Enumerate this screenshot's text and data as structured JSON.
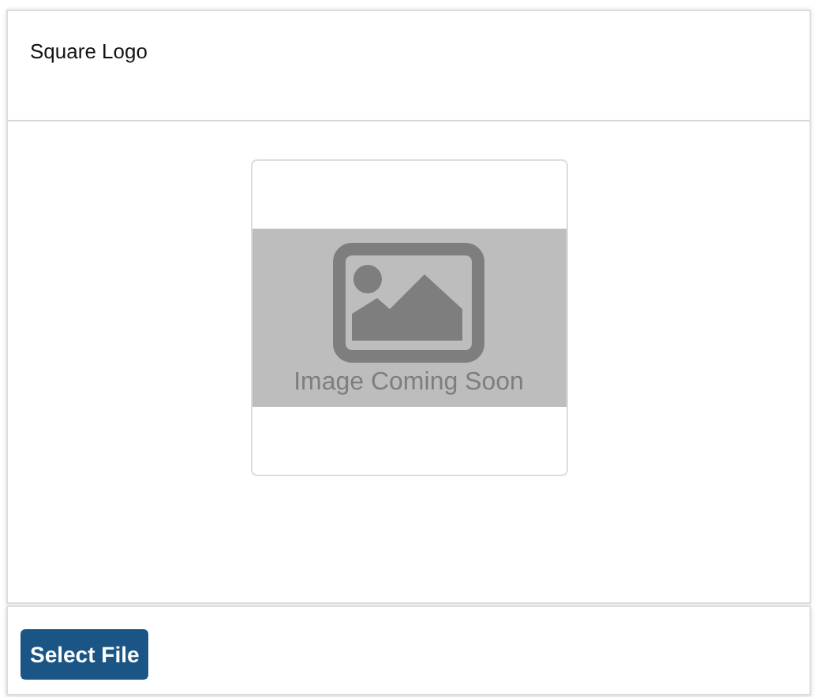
{
  "card": {
    "title": "Square Logo"
  },
  "preview": {
    "placeholder_text": "Image Coming Soon"
  },
  "footer": {
    "buttons": [
      "Select File"
    ]
  }
}
